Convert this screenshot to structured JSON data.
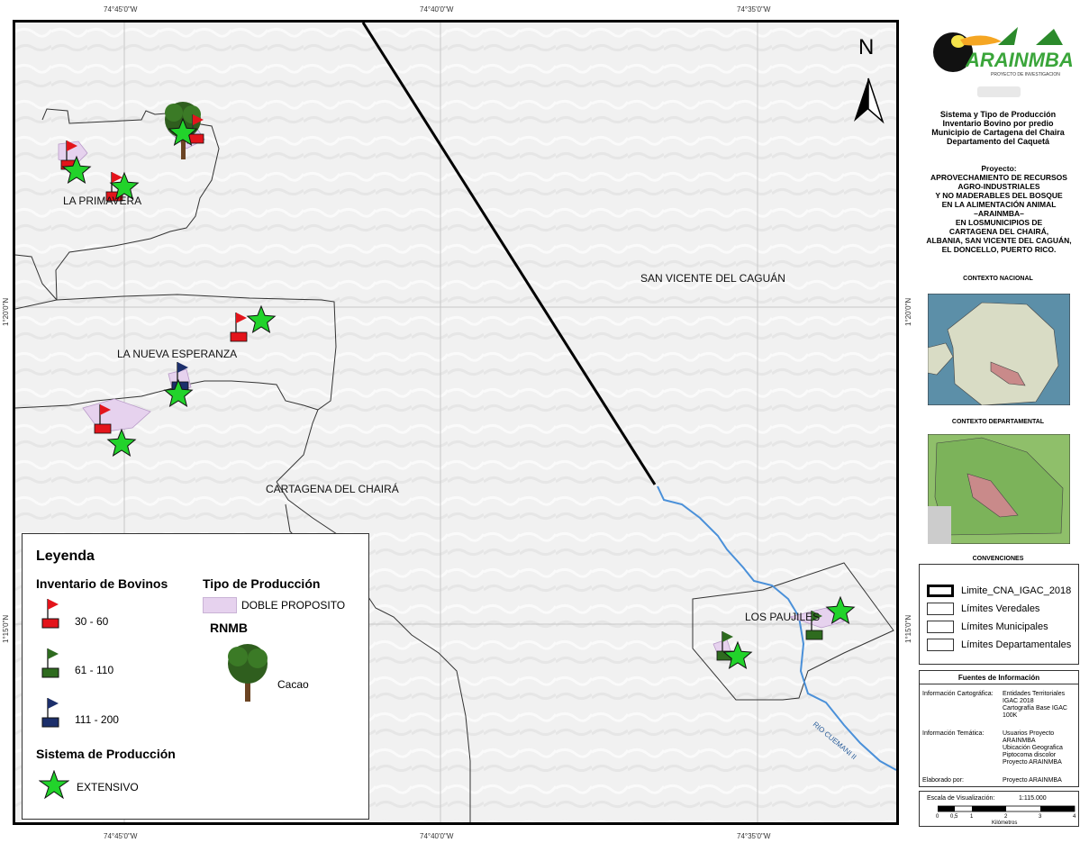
{
  "coords": {
    "top": [
      "74°45'0\"W",
      "74°40'0\"W",
      "74°35'0\"W"
    ],
    "bottom": [
      "74°45'0\"W",
      "74°40'0\"W",
      "74°35'0\"W"
    ],
    "left": [
      "1°20'0\"N",
      "1°15'0\"N"
    ],
    "right": [
      "1°20'0\"N",
      "1°15'0\"N"
    ]
  },
  "map": {
    "north_label": "N",
    "places": {
      "la_primavera": "LA PRIMAVERA",
      "la_nueva_esperanza": "LA NUEVA ESPERANZA",
      "cartagena": "CARTAGENA DEL CHAIRÁ",
      "san_vicente": "SAN VICENTE DEL CAGUÁN",
      "los_paujiles": "LOS PAUJILES"
    },
    "river_label": "RIO CUEMANI II"
  },
  "legend": {
    "title": "Leyenda",
    "inventario_title": "Inventario de Bovinos",
    "inv_items": [
      "30 - 60",
      "61 - 110",
      "111 - 200"
    ],
    "tipo_title": "Tipo de Producción",
    "tipo_item": "DOBLE PROPOSITO",
    "rnmb_title": "RNMB",
    "rnmb_item": "Cacao",
    "sistema_title": "Sistema de Producción",
    "sistema_item": "EXTENSIVO"
  },
  "panel": {
    "logo_text": "ARAINMBA",
    "logo_sub": "PROYECTO DE INVESTIGACION",
    "title_lines": [
      "Sistema y Tipo de Producción",
      "Inventario Bovino por predio",
      "Municipio de Cartagena del Chaira",
      "Departamento del Caquetá"
    ],
    "project_lines": [
      "Proyecto:",
      "APROVECHAMIENTO DE RECURSOS",
      "AGRO-INDUSTRIALES",
      "Y NO MADERABLES DEL BOSQUE",
      "EN LA ALIMENTACIÓN ANIMAL",
      "–ARAINMBA–",
      "EN LOSMUNICIPIOS DE",
      "CARTAGENA DEL CHAIRÁ,",
      "ALBANIA, SAN VICENTE DEL CAGUÁN,",
      "EL DONCELLO, PUERTO RICO."
    ],
    "contexto_nacional": "CONTEXTO NACIONAL",
    "contexto_departamental": "CONTEXTO DEPARTAMENTAL",
    "convenciones": "CONVENCIONES",
    "conv_items": [
      "Limite_CNA_IGAC_2018",
      "Límites Veredales",
      "Límites Municipales",
      "Límites Departamentales"
    ],
    "fuentes_title": "Fuentes de Información",
    "fuentes": {
      "cart_label": "Información Cartográfica:",
      "cart_value": [
        "Entidades Territoriales",
        "IGAC 2018",
        "Cartografía Base IGAC",
        "100K"
      ],
      "tem_label": "Información Temática:",
      "tem_value": [
        "Usuarios Proyecto",
        "ARAINMBA",
        "Ubicación Geografica",
        "Piptocoma discolor",
        "Proyecto ARAINMBA"
      ],
      "elab_label": "Elaborado por:",
      "elab_value": "Proyecto ARAINMBA"
    },
    "escala_label": "Escala de Visualización:",
    "escala_value": "1:115.000",
    "scale_ticks": [
      "0",
      "0,5",
      "1",
      "2",
      "3",
      "4"
    ],
    "scale_unit": "Kilómetros"
  },
  "colors": {
    "red": "#e3141b",
    "green": "#2e6b1f",
    "navy": "#1c2f6b",
    "star": "#22d32b",
    "doble": "#e6d2ee",
    "river": "#4a90d9"
  }
}
